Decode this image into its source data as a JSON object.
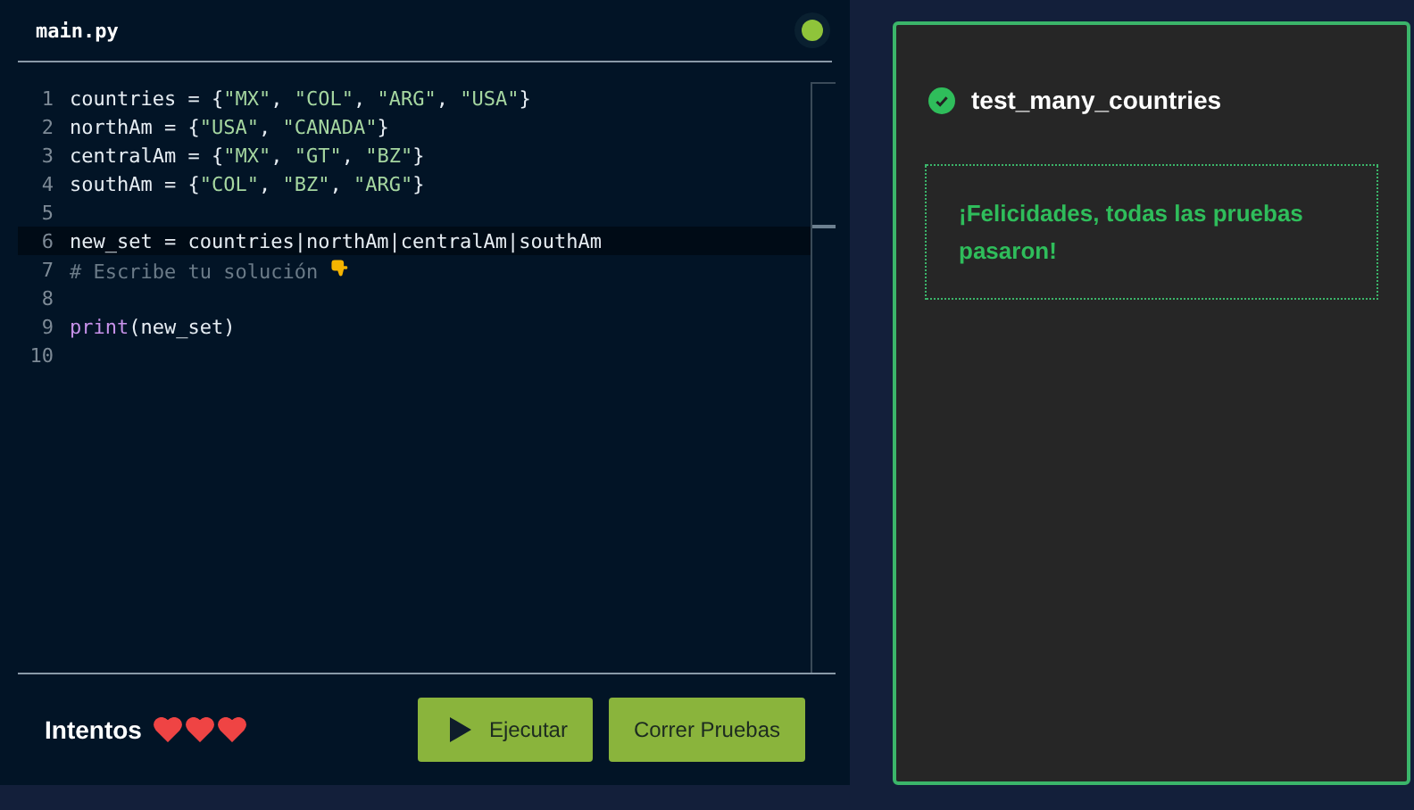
{
  "editor": {
    "filename": "main.py",
    "lines": [
      {
        "number": "1",
        "selected": false,
        "tokens": [
          {
            "kind": "plain",
            "text": "countries = {"
          },
          {
            "kind": "string",
            "text": "\"MX\""
          },
          {
            "kind": "plain",
            "text": ", "
          },
          {
            "kind": "string",
            "text": "\"COL\""
          },
          {
            "kind": "plain",
            "text": ", "
          },
          {
            "kind": "string",
            "text": "\"ARG\""
          },
          {
            "kind": "plain",
            "text": ", "
          },
          {
            "kind": "string",
            "text": "\"USA\""
          },
          {
            "kind": "plain",
            "text": "}"
          }
        ]
      },
      {
        "number": "2",
        "selected": false,
        "tokens": [
          {
            "kind": "plain",
            "text": "northAm = {"
          },
          {
            "kind": "string",
            "text": "\"USA\""
          },
          {
            "kind": "plain",
            "text": ", "
          },
          {
            "kind": "string",
            "text": "\"CANADA\""
          },
          {
            "kind": "plain",
            "text": "}"
          }
        ]
      },
      {
        "number": "3",
        "selected": false,
        "tokens": [
          {
            "kind": "plain",
            "text": "centralAm = {"
          },
          {
            "kind": "string",
            "text": "\"MX\""
          },
          {
            "kind": "plain",
            "text": ", "
          },
          {
            "kind": "string",
            "text": "\"GT\""
          },
          {
            "kind": "plain",
            "text": ", "
          },
          {
            "kind": "string",
            "text": "\"BZ\""
          },
          {
            "kind": "plain",
            "text": "}"
          }
        ]
      },
      {
        "number": "4",
        "selected": false,
        "tokens": [
          {
            "kind": "plain",
            "text": "southAm = {"
          },
          {
            "kind": "string",
            "text": "\"COL\""
          },
          {
            "kind": "plain",
            "text": ", "
          },
          {
            "kind": "string",
            "text": "\"BZ\""
          },
          {
            "kind": "plain",
            "text": ", "
          },
          {
            "kind": "string",
            "text": "\"ARG\""
          },
          {
            "kind": "plain",
            "text": "}"
          }
        ]
      },
      {
        "number": "5",
        "selected": false
      },
      {
        "number": "6",
        "selected": true,
        "tokens": [
          {
            "kind": "plain",
            "text": "new_set = countries|northAm|centralAm|southAm"
          }
        ]
      },
      {
        "number": "7",
        "selected": false,
        "tokens": [
          {
            "kind": "comment",
            "text": "# Escribe tu solución"
          },
          {
            "kind": "hand-icon"
          }
        ]
      },
      {
        "number": "8",
        "selected": false
      },
      {
        "number": "9",
        "selected": false,
        "tokens": [
          {
            "kind": "func",
            "text": "print"
          },
          {
            "kind": "plain",
            "text": "(new_set)"
          }
        ]
      },
      {
        "number": "10",
        "selected": false
      }
    ]
  },
  "footer": {
    "attempts_label": "Intentos",
    "hearts": [
      {
        "full": true
      },
      {
        "full": true
      },
      {
        "full": true
      }
    ],
    "buttons": [
      {
        "label": "Ejecutar",
        "kind": "run"
      },
      {
        "label": "Correr Pruebas",
        "kind": "test"
      }
    ]
  },
  "results": {
    "tests": [
      {
        "name": "test_many_countries",
        "passed": true
      }
    ],
    "message": "¡Felicidades, todas las pruebas pasaron!"
  }
}
